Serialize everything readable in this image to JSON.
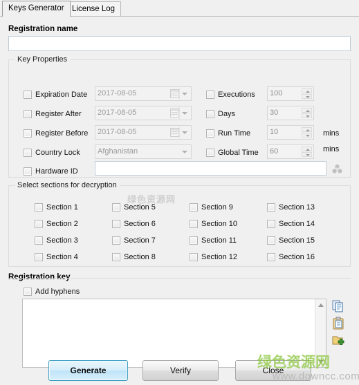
{
  "window": {
    "tabs": [
      {
        "label": "Keys Generator",
        "active": true
      },
      {
        "label": "License Log",
        "active": false
      }
    ]
  },
  "registration_name": {
    "header": "Registration name",
    "value": "",
    "placeholder": ""
  },
  "key_properties": {
    "caption": "Key Properties",
    "left_rows": [
      {
        "label": "Expiration Date",
        "checked": false,
        "value": "2017-08-05",
        "control": "datepicker"
      },
      {
        "label": "Register After",
        "checked": false,
        "value": "2017-08-05",
        "control": "datepicker"
      },
      {
        "label": "Register Before",
        "checked": false,
        "value": "2017-08-05",
        "control": "datepicker"
      },
      {
        "label": "Country Lock",
        "checked": false,
        "value": "Afghanistan",
        "control": "combobox"
      },
      {
        "label": "Hardware ID",
        "checked": false,
        "value": "",
        "control": "textbox"
      }
    ],
    "right_rows": [
      {
        "label": "Executions",
        "checked": false,
        "value": "100",
        "unit": ""
      },
      {
        "label": "Days",
        "checked": false,
        "value": "30",
        "unit": ""
      },
      {
        "label": "Run Time",
        "checked": false,
        "value": "10",
        "unit": "mins"
      },
      {
        "label": "Global Time",
        "checked": false,
        "value": "60",
        "unit": "mins"
      }
    ],
    "hardware_icon": "hardware-chip-icon"
  },
  "sections": {
    "caption": "Select sections for decryption",
    "items": [
      {
        "label": "Section 1",
        "checked": false
      },
      {
        "label": "Section 5",
        "checked": false
      },
      {
        "label": "Section 9",
        "checked": false
      },
      {
        "label": "Section 13",
        "checked": false
      },
      {
        "label": "Section 2",
        "checked": false
      },
      {
        "label": "Section 6",
        "checked": false
      },
      {
        "label": "Section 10",
        "checked": false
      },
      {
        "label": "Section 14",
        "checked": false
      },
      {
        "label": "Section 3",
        "checked": false
      },
      {
        "label": "Section 7",
        "checked": false
      },
      {
        "label": "Section 11",
        "checked": false
      },
      {
        "label": "Section 15",
        "checked": false
      },
      {
        "label": "Section 4",
        "checked": false
      },
      {
        "label": "Section 8",
        "checked": false
      },
      {
        "label": "Section 12",
        "checked": false
      },
      {
        "label": "Section 16",
        "checked": false
      }
    ]
  },
  "registration_key": {
    "header": "Registration key",
    "add_hyphens_label": "Add hyphens",
    "add_hyphens_checked": false,
    "value": "",
    "tools": [
      {
        "name": "copy-icon"
      },
      {
        "name": "paste-icon"
      },
      {
        "name": "save-to-file-icon"
      }
    ]
  },
  "buttons": {
    "generate": "Generate",
    "verify": "Verify",
    "close": "Close"
  },
  "watermark": {
    "chinese": "绿色资源网",
    "url": "www.downcc.com",
    "faint": "绿色资源网"
  },
  "colors": {
    "background": "#f0f0f0",
    "accent": "#3c9ec4",
    "watermark_green": "#8cc63f"
  }
}
